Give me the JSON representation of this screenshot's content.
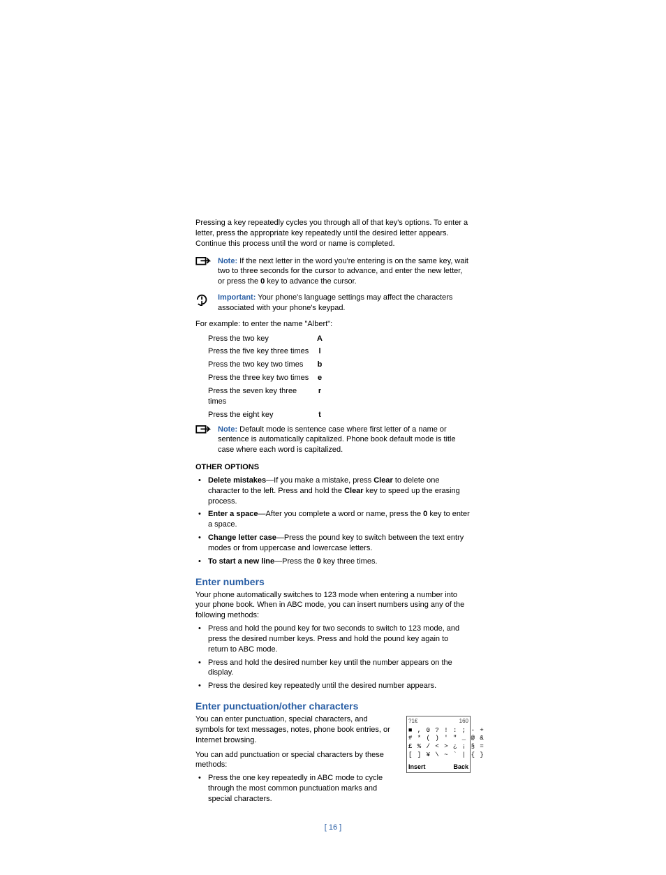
{
  "intro": "Pressing a key repeatedly cycles you through all of that key's options. To enter a letter, press the appropriate key repeatedly until the desired letter appears. Continue this process until the word or name is completed.",
  "note1": {
    "label": "Note:",
    "text": " If the next letter in the word you're entering is on the same key, wait two to three seconds for the cursor to advance, and enter the new letter, or press the ",
    "key": "0",
    "textAfter": " key to advance the cursor."
  },
  "important1": {
    "label": "Important:",
    "text": " Your phone's language settings may affect the characters associated with your phone's keypad."
  },
  "exampleIntro": "For example: to enter the name \"Albert\":",
  "keyTable": [
    {
      "action": "Press the two key",
      "letter": "A"
    },
    {
      "action": "Press the five key three times",
      "letter": "l"
    },
    {
      "action": "Press the two key two times",
      "letter": "b"
    },
    {
      "action": "Press the three key two times",
      "letter": "e"
    },
    {
      "action": "Press the seven key three times",
      "letter": "r"
    },
    {
      "action": "Press the eight key",
      "letter": "t"
    }
  ],
  "note2": {
    "label": "Note:",
    "text": " Default mode is sentence case where first letter of a name or sentence is automatically capitalized. Phone book default mode is title case where each word is capitalized."
  },
  "otherOptionsHeading": "OTHER OPTIONS",
  "otherOptions": {
    "delete": {
      "lead": "Delete mistakes",
      "t1": "—If you make a mistake, press ",
      "k1": "Clear",
      "t2": " to delete one character to the left. Press and hold the ",
      "k2": "Clear",
      "t3": " key to speed up the erasing process."
    },
    "space": {
      "lead": "Enter a space",
      "t1": "—After you complete a word or name, press the ",
      "k1": "0",
      "t2": " key to enter a space."
    },
    "case": {
      "lead": "Change letter case",
      "t1": "—Press the pound key to switch between the text entry modes or from uppercase and lowercase letters."
    },
    "newline": {
      "lead": "To start a new line",
      "t1": "—Press the ",
      "k1": "0",
      "t2": " key three times."
    }
  },
  "enterNumbersHeading": "Enter numbers",
  "enterNumbersIntro": "Your phone automatically switches to 123 mode when entering a number into your phone book. When in ABC mode, you can insert numbers using any of the following methods:",
  "enterNumbersBullets": [
    "Press and hold the pound key for two seconds to switch to 123 mode, and press the desired number keys. Press and hold the pound key again to return to ABC mode.",
    "Press and hold the desired number key until the number appears on the display.",
    "Press the desired key repeatedly until the desired number appears."
  ],
  "enterPunctHeading": "Enter punctuation/other characters",
  "enterPunctP1": "You can enter punctuation, special characters, and symbols for text messages, notes, phone book entries, or Internet browsing.",
  "enterPunctP2": "You can add punctuation or special characters by these methods:",
  "enterPunctBullets": [
    "Press the one key repeatedly in ABC mode to cycle through the most common punctuation marks and special characters."
  ],
  "phone": {
    "topLeft": "?1€",
    "topRight": "160",
    "line1": "■ , 0 ? ! : ; - +",
    "line2": "# * ( ) ' \" _ @ &",
    "line3": "£ % / < > ¿ ¡ § =",
    "line4": "[ ] ¥ \\ ~ ` | { }",
    "bottomLeft": "Insert",
    "bottomRight": "Back"
  },
  "pageNumber": "[ 16 ]"
}
